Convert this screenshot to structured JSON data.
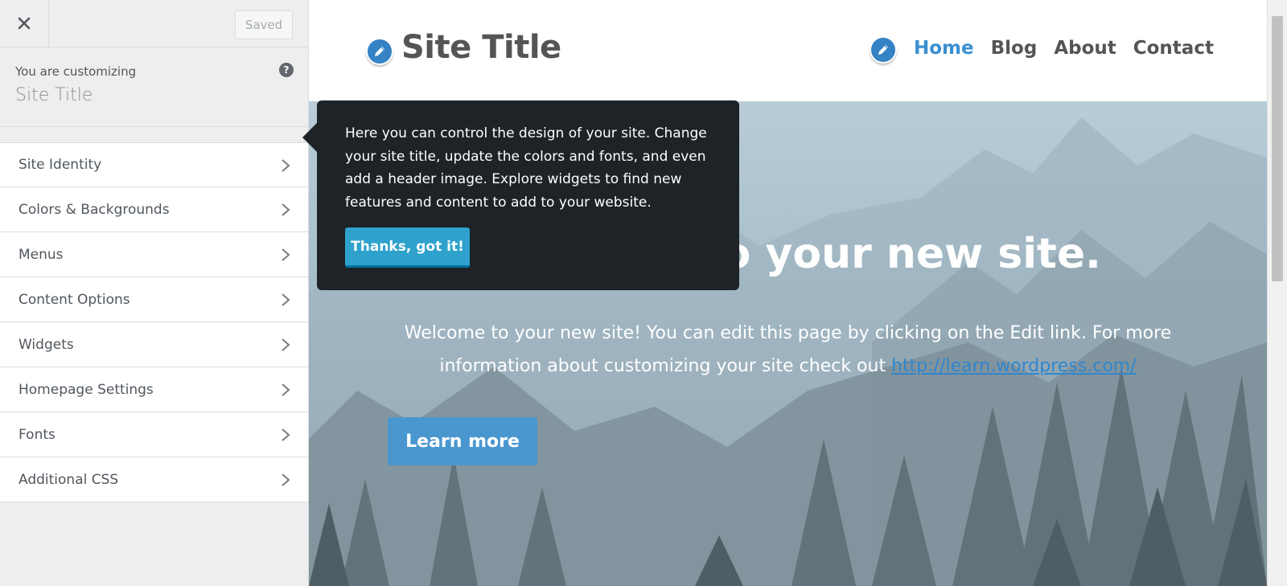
{
  "customizer": {
    "close_icon": "close-icon",
    "save_label": "Saved",
    "info_action": "You are customizing",
    "info_title": "Site Title",
    "help_icon": "?",
    "sections": [
      {
        "label": "Site Identity"
      },
      {
        "label": "Colors & Backgrounds"
      },
      {
        "label": "Menus"
      },
      {
        "label": "Content Options"
      },
      {
        "label": "Widgets"
      },
      {
        "label": "Homepage Settings"
      },
      {
        "label": "Fonts"
      },
      {
        "label": "Additional CSS"
      }
    ]
  },
  "preview": {
    "site_title": "Site Title",
    "nav": [
      {
        "label": "Home",
        "active": true
      },
      {
        "label": "Blog"
      },
      {
        "label": "About"
      },
      {
        "label": "Contact"
      }
    ],
    "hero_heading": "Welcome to your new site.",
    "hero_text": "Welcome to your new site! You can edit this page by clicking on the Edit link. For more information about customizing your site check out",
    "hero_link": "http://learn.wordpress.com/",
    "hero_button": "Learn more"
  },
  "tooltip": {
    "text": "Here you can control the design of your site. Change your site title, update the colors and fonts, and even add a header image. Explore widgets to find new features and content to add to your website.",
    "button": "Thanks, got it!"
  },
  "colors": {
    "accent": "#3a8fd0",
    "tooltip_bg": "#1d2327",
    "tooltip_button": "#2ea2cc"
  }
}
